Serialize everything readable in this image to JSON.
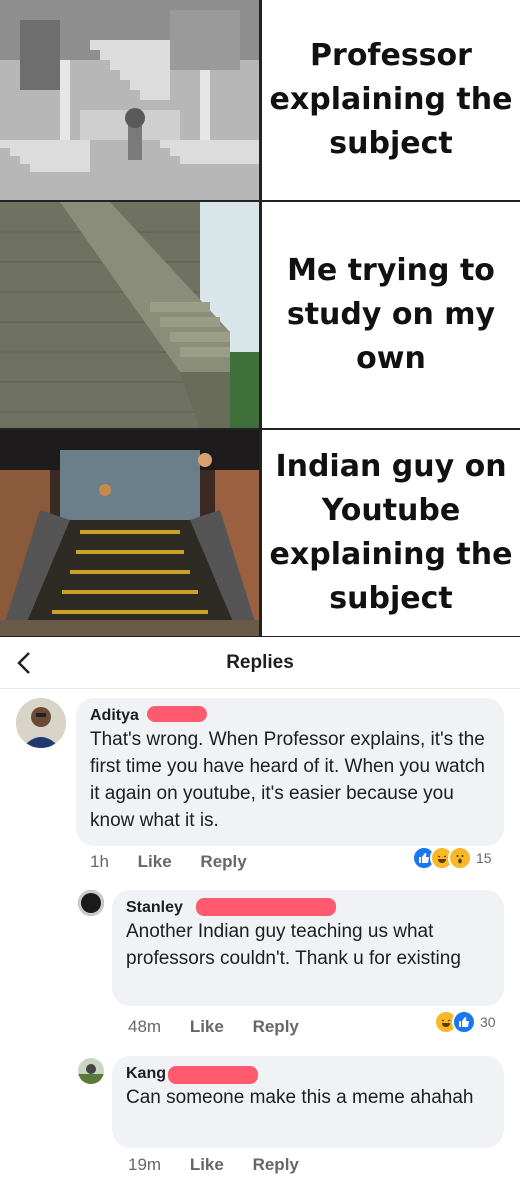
{
  "meme": {
    "captions": [
      "Professor explaining the subject",
      "Me trying to study on my own",
      "Indian guy on Youtube explaining the subject"
    ]
  },
  "header": {
    "back_icon": "chevron-left-icon",
    "title": "Replies"
  },
  "comments": [
    {
      "name": "Aditya",
      "text": "That's wrong. When Professor explains, it's the first time you have heard of it. When you watch it again on youtube, it's easier because you know what it is.",
      "time": "1h",
      "like": "Like",
      "reply": "Reply",
      "reactions": {
        "icons": [
          "like-icon",
          "haha-icon",
          "wow-icon"
        ],
        "count": "15"
      }
    },
    {
      "name": "Stanley",
      "text": "Another Indian guy teaching us what professors couldn't. Thank u for existing",
      "time": "48m",
      "like": "Like",
      "reply": "Reply",
      "reactions": {
        "icons": [
          "haha-icon",
          "like-icon"
        ],
        "count": "30"
      }
    },
    {
      "name": "Kang",
      "text": "Can someone make this a meme ahahah",
      "time": "19m",
      "like": "Like",
      "reply": "Reply"
    }
  ],
  "colors": {
    "like_blue": "#1877f2",
    "haha_yellow": "#f7b928",
    "redaction_red": "#ff5a6e",
    "bubble_gray": "#f0f2f5"
  }
}
